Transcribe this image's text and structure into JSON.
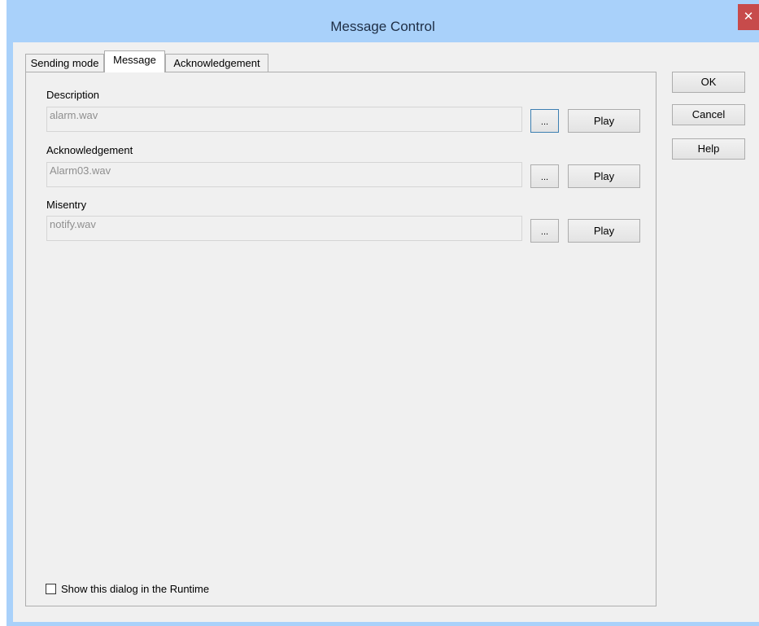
{
  "window": {
    "title": "Message Control",
    "close_glyph": "✕"
  },
  "tabs": [
    {
      "label": "Sending mode",
      "active": false
    },
    {
      "label": "Message",
      "active": true
    },
    {
      "label": "Acknowledgement",
      "active": false
    }
  ],
  "sounds": [
    {
      "label": "Description",
      "file": "alarm.wav",
      "browse": "...",
      "play": "Play"
    },
    {
      "label": "Acknowledgement",
      "file": "Alarm03.wav",
      "browse": "...",
      "play": "Play"
    },
    {
      "label": "Misentry",
      "file": "notify.wav",
      "browse": "...",
      "play": "Play"
    }
  ],
  "checkbox": {
    "label": "Show this dialog in the Runtime",
    "checked": false
  },
  "buttons": {
    "ok": "OK",
    "cancel": "Cancel",
    "help": "Help"
  },
  "colors": {
    "titlebar": "#a9d1fa",
    "close": "#c74b4b",
    "client": "#f0f0f0",
    "focus_border": "#3c7fb1"
  },
  "icons": {
    "close": "close-icon",
    "checkbox": "checkbox-unchecked"
  }
}
